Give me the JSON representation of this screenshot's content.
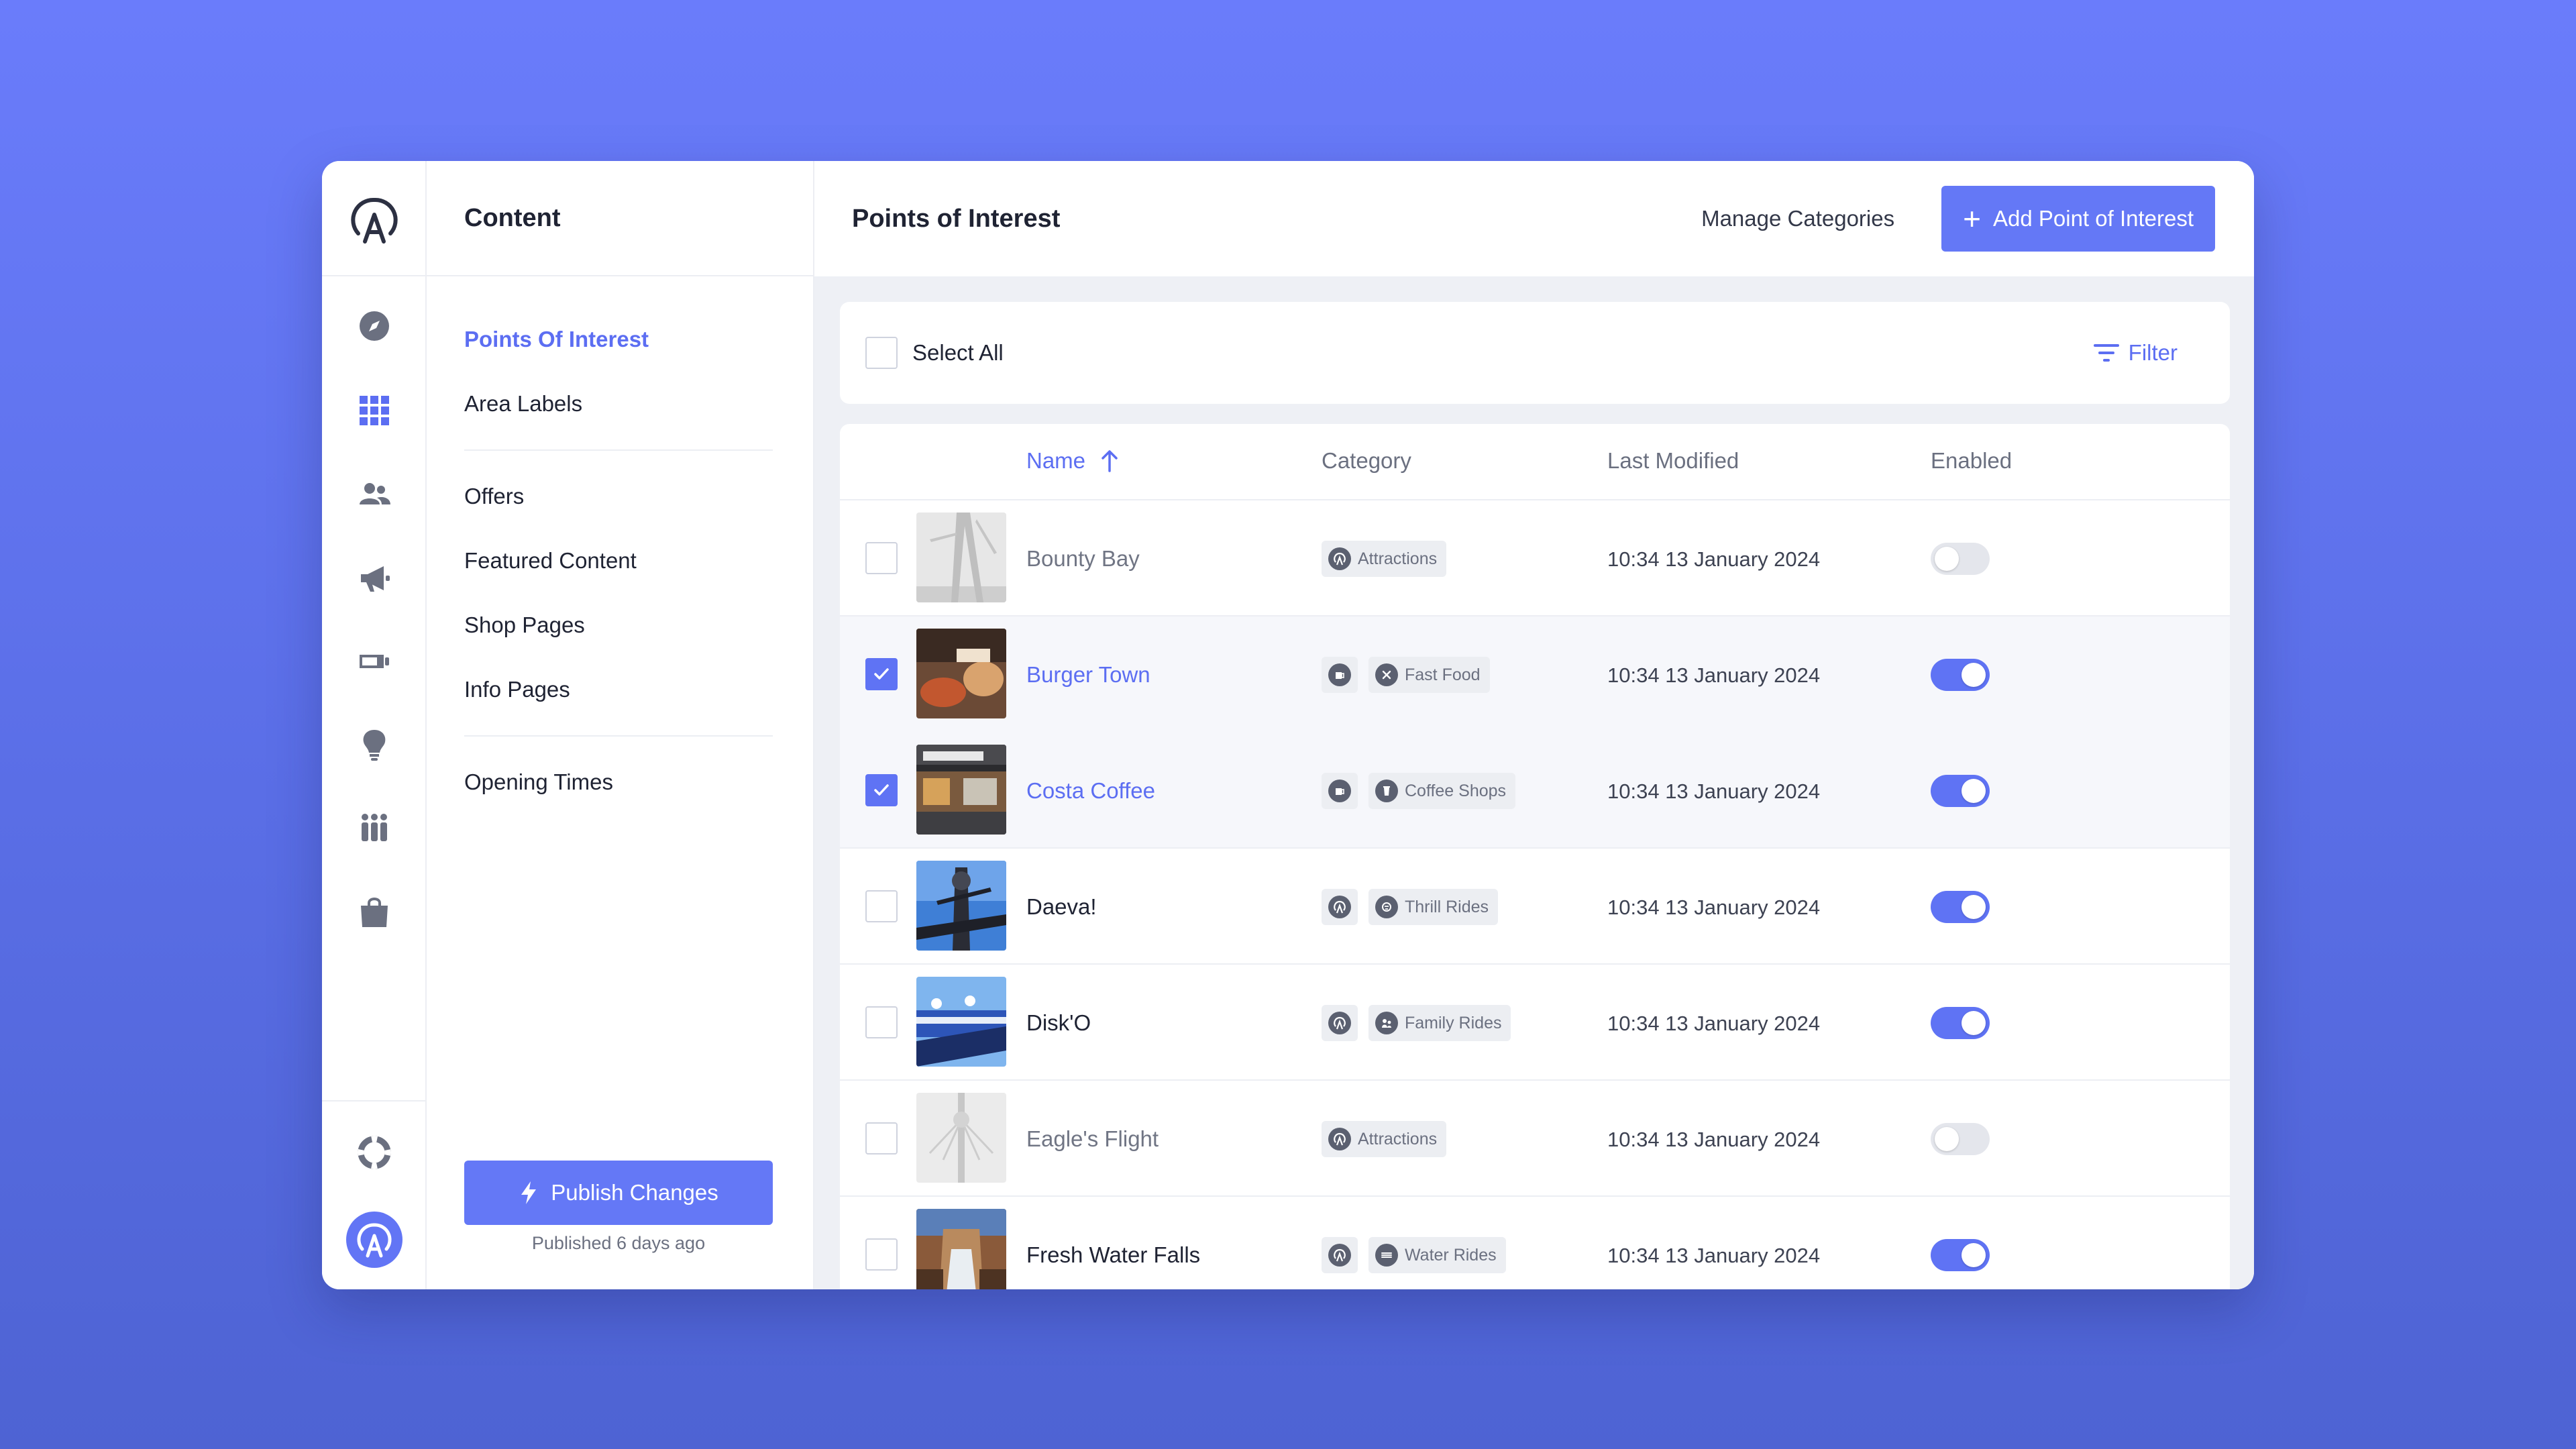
{
  "rail": {
    "nav_icons": [
      "compass-icon",
      "grid-icon",
      "users-icon",
      "megaphone-icon",
      "ticket-icon",
      "lightbulb-icon",
      "group-icon",
      "shopping-bag-icon"
    ],
    "bottom_icons": [
      "help-lifebuoy-icon",
      "account-avatar-icon"
    ]
  },
  "menu": {
    "title": "Content",
    "group1": [
      "Points Of Interest",
      "Area Labels"
    ],
    "group2": [
      "Offers",
      "Featured Content",
      "Shop Pages",
      "Info Pages"
    ],
    "group3": [
      "Opening Times"
    ],
    "active": "Points Of Interest",
    "publish_label": "Publish Changes",
    "published_note": "Published 6 days ago"
  },
  "header": {
    "title": "Points of Interest",
    "manage_label": "Manage Categories",
    "add_label": "Add Point of Interest"
  },
  "toolbar": {
    "select_all_label": "Select All",
    "filter_label": "Filter"
  },
  "table": {
    "columns": {
      "name": "Name",
      "category": "Category",
      "modified": "Last Modified",
      "enabled": "Enabled"
    },
    "sort": {
      "column": "Name",
      "direction": "ascending"
    },
    "rows": [
      {
        "name": "Bounty Bay",
        "checked": false,
        "enabled": false,
        "type_icon": false,
        "category": "Attractions",
        "modified": "10:34 13 January 2024"
      },
      {
        "name": "Burger Town",
        "checked": true,
        "enabled": true,
        "type_icon": true,
        "category": "Fast Food",
        "modified": "10:34 13 January 2024"
      },
      {
        "name": "Costa Coffee",
        "checked": true,
        "enabled": true,
        "type_icon": true,
        "category": "Coffee Shops",
        "modified": "10:34 13 January 2024"
      },
      {
        "name": "Daeva!",
        "checked": false,
        "enabled": true,
        "type_icon": true,
        "category": "Thrill Rides",
        "modified": "10:34 13 January 2024"
      },
      {
        "name": "Disk'O",
        "checked": false,
        "enabled": true,
        "type_icon": true,
        "category": "Family Rides",
        "modified": "10:34 13 January 2024"
      },
      {
        "name": "Eagle's Flight",
        "checked": false,
        "enabled": false,
        "type_icon": false,
        "category": "Attractions",
        "modified": "10:34 13 January 2024"
      },
      {
        "name": "Fresh Water Falls",
        "checked": false,
        "enabled": true,
        "type_icon": true,
        "category": "Water Rides",
        "modified": "10:34 13 January 2024"
      }
    ]
  },
  "colors": {
    "accent": "#6478f6",
    "background": "#6a7cfb",
    "toggle_off": "#e4e6ec"
  }
}
